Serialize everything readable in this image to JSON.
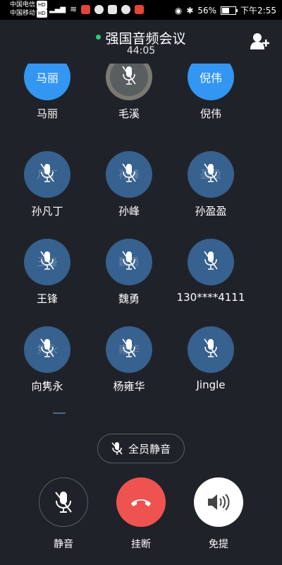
{
  "status_bar": {
    "carrier1": "中国电信",
    "carrier2": "中国移动",
    "hd": "HD",
    "battery": "56%",
    "battery_level": 0.56,
    "time": "下午2:55"
  },
  "header": {
    "title": "强国音频会议",
    "elapsed": "44:05",
    "add_icon": "add-person-icon",
    "status_color": "#2ecc71"
  },
  "participants": [
    {
      "name": "马丽",
      "avatar_text": "马丽",
      "style": "blue"
    },
    {
      "name": "毛溪",
      "avatar_text": "",
      "style": "gray"
    },
    {
      "name": "倪伟",
      "avatar_text": "倪伟",
      "style": "blue"
    },
    {
      "name": "孙凡丁",
      "avatar_text": "凡丁",
      "style": "muted"
    },
    {
      "name": "孙峰",
      "avatar_text": "孙峰",
      "style": "muted"
    },
    {
      "name": "孙盈盈",
      "avatar_text": "盈盈",
      "style": "muted"
    },
    {
      "name": "王锋",
      "avatar_text": "王锋",
      "style": "muted"
    },
    {
      "name": "魏勇",
      "avatar_text": "魏勇",
      "style": "muted"
    },
    {
      "name": "130****4111",
      "avatar_text": "",
      "style": "muted"
    },
    {
      "name": "向隽永",
      "avatar_text": "隽永",
      "style": "muted"
    },
    {
      "name": "杨雍华",
      "avatar_text": "雍华",
      "style": "muted"
    },
    {
      "name": "Jingle",
      "avatar_text": "",
      "style": "muted"
    }
  ],
  "mute_all": {
    "label": "全员静音"
  },
  "controls": {
    "mute_label": "静音",
    "hangup_label": "挂断",
    "speaker_label": "免提"
  },
  "colors": {
    "background": "#1f2329",
    "avatar_muted": "#37618e",
    "avatar_active": "#3296f2",
    "hangup": "#ef5350"
  }
}
